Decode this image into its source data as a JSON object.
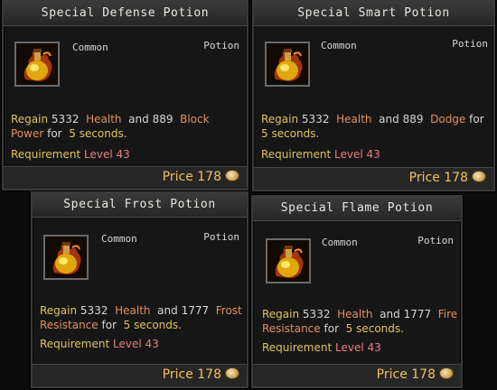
{
  "colors": {
    "gold": "#e2c25b",
    "orange": "#e4905a",
    "level_red": "#e87f7f",
    "price": "#f0c05a"
  },
  "cards": [
    {
      "title": "Special Defense Potion",
      "rarity": "Common",
      "type": "Potion",
      "icon": "flame-potion-flask-icon",
      "desc": {
        "regain": "Regain",
        "amount1": "5332",
        "stat1": "Health",
        "and": "and",
        "amount2": "889",
        "stat2": "Block Power",
        "for": "for",
        "duration": "5 seconds."
      },
      "requirement": {
        "label": "Requirement",
        "level": "Level 43"
      },
      "price": {
        "label": "Price",
        "value": "178"
      }
    },
    {
      "title": "Special Smart Potion",
      "rarity": "Common",
      "type": "Potion",
      "icon": "flame-potion-flask-icon",
      "desc": {
        "regain": "Regain",
        "amount1": "5332",
        "stat1": "Health",
        "and": "and",
        "amount2": "889",
        "stat2": "Dodge",
        "for": "for",
        "duration": "5 seconds."
      },
      "requirement": {
        "label": "Requirement",
        "level": "Level 43"
      },
      "price": {
        "label": "Price",
        "value": "178"
      }
    },
    {
      "title": "Special Frost Potion",
      "rarity": "Common",
      "type": "Potion",
      "icon": "flame-potion-flask-icon",
      "desc": {
        "regain": "Regain",
        "amount1": "5332",
        "stat1": "Health",
        "and": "and",
        "amount2": "1777",
        "stat2": "Frost Resistance",
        "for": "for",
        "duration": "5 seconds."
      },
      "requirement": {
        "label": "Requirement",
        "level": "Level 43"
      },
      "price": {
        "label": "Price",
        "value": "178"
      }
    },
    {
      "title": "Special Flame Potion",
      "rarity": "Common",
      "type": "Potion",
      "icon": "flame-potion-flask-icon",
      "desc": {
        "regain": "Regain",
        "amount1": "5332",
        "stat1": "Health",
        "and": "and",
        "amount2": "1777",
        "stat2": "Fire Resistance",
        "for": "for",
        "duration": "5 seconds."
      },
      "requirement": {
        "label": "Requirement",
        "level": "Level 43"
      },
      "price": {
        "label": "Price",
        "value": "178"
      }
    }
  ]
}
